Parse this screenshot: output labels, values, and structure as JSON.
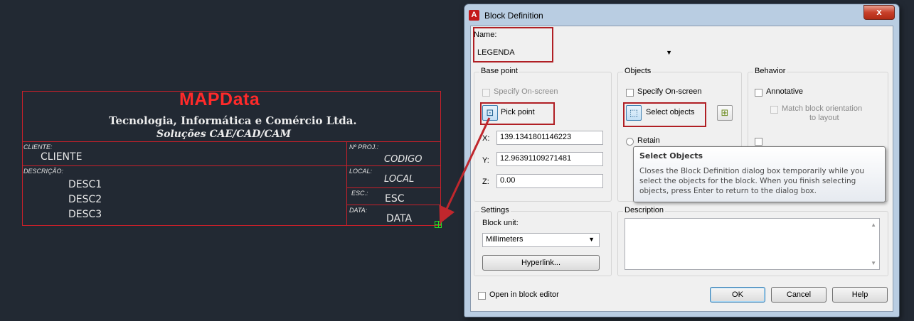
{
  "cad_legend": {
    "company": "MAPData",
    "subtitle1": "Tecnologia,  Informática e Comércio Ltda.",
    "subtitle2": "Soluções CAE/CAD/CAM",
    "client_label": "CLIENTE:",
    "client_value": "CLIENTE",
    "project_label": "Nº PROJ.:",
    "project_value": "CODIGO",
    "description_label": "DESCRIÇÃO:",
    "description_lines": [
      "DESC1",
      "DESC2",
      "DESC3"
    ],
    "local_label": "LOCAL:",
    "local_value": "LOCAL",
    "scale_label": "ESC.:",
    "scale_value": "ESC",
    "date_label": "DATA:",
    "date_value": "DATA"
  },
  "dialog": {
    "title": "Block Definition",
    "close_glyph": "x",
    "name_label": "Name:",
    "name_value": "LEGENDA",
    "base_point": {
      "title": "Base point",
      "specify_label": "Specify On-screen",
      "pick_label": "Pick point",
      "x_label": "X:",
      "x_value": "139.1341801146223",
      "y_label": "Y:",
      "y_value": "12.96391109271481",
      "z_label": "Z:",
      "z_value": "0.00"
    },
    "objects": {
      "title": "Objects",
      "specify_label": "Specify On-screen",
      "select_label": "Select objects",
      "retain_label": "Retain"
    },
    "behavior": {
      "title": "Behavior",
      "annotative_label": "Annotative",
      "match_label_line1": "Match block orientation",
      "match_label_line2": "to layout"
    },
    "tooltip": {
      "title": "Select Objects",
      "body_line1": "Closes the Block Definition dialog box temporarily while you",
      "body_line2": "select the objects for the block. When you finish selecting",
      "body_line3": "objects, press Enter to return to the dialog box."
    },
    "settings": {
      "title": "Settings",
      "block_unit_label": "Block unit:",
      "block_unit_value": "Millimeters",
      "hyperlink_label": "Hyperlink..."
    },
    "description": {
      "title": "Description"
    },
    "open_editor_label": "Open in block editor",
    "ok_label": "OK",
    "cancel_label": "Cancel",
    "help_label": "Help"
  },
  "colors": {
    "cad_background": "#222933",
    "legend_red": "#c8202a",
    "company_red": "#ff2a2a",
    "grip_green": "#25e025",
    "highlight_red": "#b01f24",
    "arrow_red": "#c0272d"
  }
}
